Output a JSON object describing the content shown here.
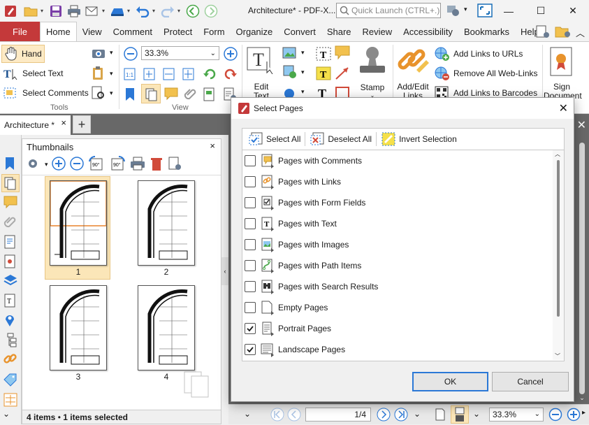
{
  "window": {
    "title": "Architecture* - PDF-X...",
    "search_placeholder": "Quick Launch (CTRL+.)",
    "minimize": "—",
    "maximize": "☐",
    "close": "✕"
  },
  "ribbon_tabs": [
    "File",
    "Home",
    "View",
    "Comment",
    "Protect",
    "Form",
    "Organize",
    "Convert",
    "Share",
    "Review",
    "Accessibility",
    "Bookmarks",
    "Help"
  ],
  "ribbon": {
    "hand": "Hand",
    "select_text": "Select Text",
    "select_comments": "Select Comments",
    "tools_label": "Tools",
    "zoom": "33.3%",
    "view_label": "View",
    "edit_text": "Edit",
    "edit_text2": "Text",
    "stamp": "Stamp",
    "add_edit_links": "Add/Edit",
    "add_edit_links2": "Links",
    "add_links_urls": "Add Links to URLs",
    "remove_web_links": "Remove All Web-Links",
    "add_links_barcodes": "Add Links to Barcodes",
    "sign_document": "Sign",
    "sign_document2": "Document"
  },
  "doc_tab": {
    "label": "Architecture *",
    "close": "×",
    "new_tab": "+"
  },
  "thumbnails": {
    "title": "Thumbnails",
    "close": "×",
    "pages": [
      "1",
      "2",
      "3",
      "4"
    ],
    "status_count": "4 items",
    "status_sep": "•",
    "status_selected": "1 items selected"
  },
  "status_bar": {
    "page_indicator": "1/4",
    "zoom": "33.3%"
  },
  "dialog": {
    "title": "Select Pages",
    "select_all": "Select All",
    "deselect_all": "Deselect All",
    "invert_selection": "Invert Selection",
    "items": [
      {
        "label": "Pages with Comments",
        "checked": false,
        "icon": "comment-icon"
      },
      {
        "label": "Pages with Links",
        "checked": false,
        "icon": "link-icon"
      },
      {
        "label": "Pages with Form Fields",
        "checked": false,
        "icon": "form-field-icon"
      },
      {
        "label": "Pages with Text",
        "checked": false,
        "icon": "text-icon"
      },
      {
        "label": "Pages with Images",
        "checked": false,
        "icon": "image-icon"
      },
      {
        "label": "Pages with Path Items",
        "checked": false,
        "icon": "path-icon"
      },
      {
        "label": "Pages with Search Results",
        "checked": false,
        "icon": "binoculars-icon"
      },
      {
        "label": "Empty Pages",
        "checked": false,
        "icon": "empty-page-icon"
      },
      {
        "label": "Portrait Pages",
        "checked": true,
        "icon": "portrait-page-icon"
      },
      {
        "label": "Landscape Pages",
        "checked": true,
        "icon": "landscape-page-icon"
      }
    ],
    "ok": "OK",
    "cancel": "Cancel"
  },
  "colors": {
    "file_tab": "#c4393a",
    "selection": "#fbe6b8",
    "doc_background": "#686868",
    "default_button_border": "#2b78d6"
  }
}
